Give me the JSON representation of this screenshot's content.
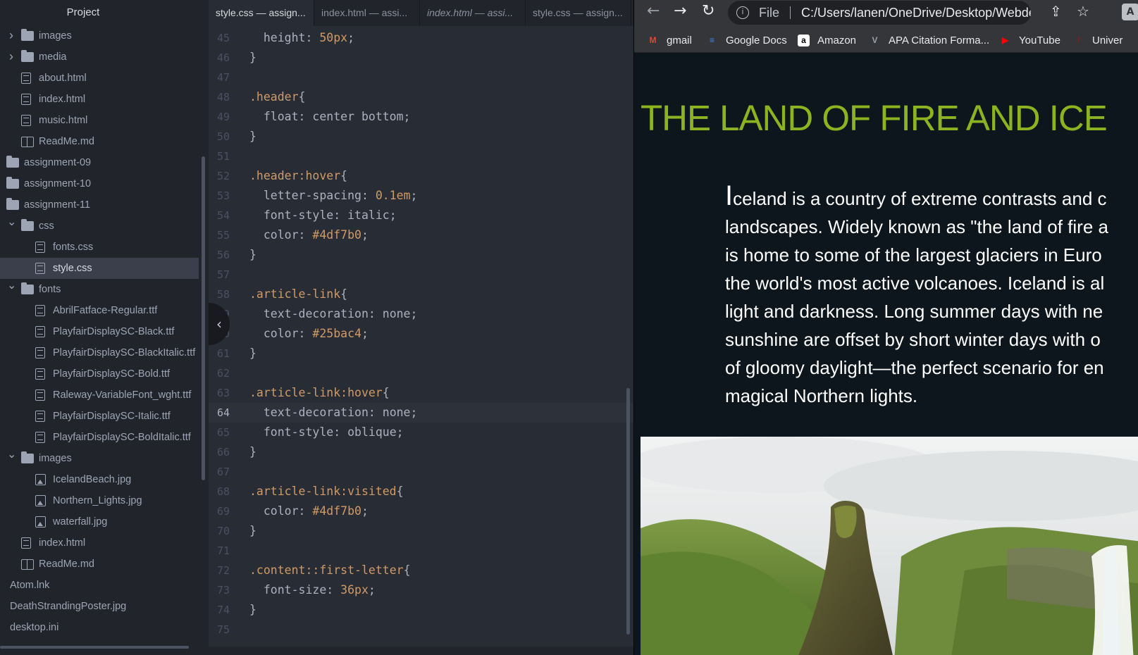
{
  "tree": {
    "title": "Project",
    "items": [
      {
        "label": "images",
        "type": "folder",
        "depth": 1,
        "chevron": "right"
      },
      {
        "label": "media",
        "type": "folder",
        "depth": 1,
        "chevron": "right"
      },
      {
        "label": "about.html",
        "type": "file",
        "depth": 1
      },
      {
        "label": "index.html",
        "type": "file",
        "depth": 1
      },
      {
        "label": "music.html",
        "type": "file",
        "depth": 1
      },
      {
        "label": "ReadMe.md",
        "type": "book",
        "depth": 1
      },
      {
        "label": "assignment-09",
        "type": "folder",
        "depth": 0
      },
      {
        "label": "assignment-10",
        "type": "folder",
        "depth": 0
      },
      {
        "label": "assignment-11",
        "type": "folder",
        "depth": 0
      },
      {
        "label": "css",
        "type": "folder",
        "depth": 1,
        "chevron": "down"
      },
      {
        "label": "fonts.css",
        "type": "file",
        "depth": 2
      },
      {
        "label": "style.css",
        "type": "file",
        "depth": 2,
        "selected": true
      },
      {
        "label": "fonts",
        "type": "folder",
        "depth": 1,
        "chevron": "down"
      },
      {
        "label": "AbrilFatface-Regular.ttf",
        "type": "file",
        "depth": 2
      },
      {
        "label": "PlayfairDisplaySC-Black.ttf",
        "type": "file",
        "depth": 2
      },
      {
        "label": "PlayfairDisplaySC-BlackItalic.ttf",
        "type": "file",
        "depth": 2
      },
      {
        "label": "PlayfairDisplaySC-Bold.ttf",
        "type": "file",
        "depth": 2
      },
      {
        "label": "Raleway-VariableFont_wght.ttf",
        "type": "file",
        "depth": 2
      },
      {
        "label": "PlayfairDisplaySC-Italic.ttf",
        "type": "file",
        "depth": 2
      },
      {
        "label": "PlayfairDisplaySC-BoldItalic.ttf",
        "type": "file",
        "depth": 2
      },
      {
        "label": "images",
        "type": "folder",
        "depth": 1,
        "chevron": "down"
      },
      {
        "label": "IcelandBeach.jpg",
        "type": "image",
        "depth": 2
      },
      {
        "label": "Northern_Lights.jpg",
        "type": "image",
        "depth": 2
      },
      {
        "label": "waterfall.jpg",
        "type": "image",
        "depth": 2
      },
      {
        "label": "index.html",
        "type": "file",
        "depth": 1
      },
      {
        "label": "ReadMe.md",
        "type": "book",
        "depth": 1
      },
      {
        "label": "Atom.lnk",
        "type": "none",
        "depth": -1
      },
      {
        "label": "DeathStrandingPoster.jpg",
        "type": "none",
        "depth": -1
      },
      {
        "label": "desktop.ini",
        "type": "none",
        "depth": -1
      }
    ]
  },
  "editor": {
    "tabs": [
      {
        "label": "style.css — assign...",
        "active": true,
        "italic": false
      },
      {
        "label": "index.html — assi...",
        "active": false,
        "italic": false
      },
      {
        "label": "index.html — assi...",
        "active": false,
        "italic": true
      },
      {
        "label": "style.css — assign...",
        "active": false,
        "italic": false
      }
    ],
    "current_line": "64",
    "lines": [
      {
        "n": "45",
        "tokens": [
          [
            "  ",
            "pun"
          ],
          [
            "height",
            "prop"
          ],
          [
            ": ",
            "pun"
          ],
          [
            "50px",
            "num"
          ],
          [
            ";",
            "pun"
          ]
        ]
      },
      {
        "n": "46",
        "tokens": [
          [
            "}",
            "pun"
          ]
        ]
      },
      {
        "n": "47",
        "tokens": []
      },
      {
        "n": "48",
        "tokens": [
          [
            ".header",
            "sel"
          ],
          [
            "{",
            "pun"
          ]
        ]
      },
      {
        "n": "49",
        "tokens": [
          [
            "  ",
            "pun"
          ],
          [
            "float",
            "prop"
          ],
          [
            ": center bottom;",
            "pun"
          ]
        ]
      },
      {
        "n": "50",
        "tokens": [
          [
            "}",
            "pun"
          ]
        ]
      },
      {
        "n": "51",
        "tokens": []
      },
      {
        "n": "52",
        "tokens": [
          [
            ".header",
            "sel"
          ],
          [
            ":hover",
            "sel"
          ],
          [
            "{",
            "pun"
          ]
        ]
      },
      {
        "n": "53",
        "tokens": [
          [
            "  ",
            "pun"
          ],
          [
            "letter-spacing",
            "prop"
          ],
          [
            ": ",
            "pun"
          ],
          [
            "0.1em",
            "num"
          ],
          [
            ";",
            "pun"
          ]
        ]
      },
      {
        "n": "54",
        "tokens": [
          [
            "  ",
            "pun"
          ],
          [
            "font-style",
            "prop"
          ],
          [
            ": italic;",
            "pun"
          ]
        ]
      },
      {
        "n": "55",
        "tokens": [
          [
            "  ",
            "pun"
          ],
          [
            "color",
            "prop"
          ],
          [
            ": ",
            "pun"
          ],
          [
            "#4df7b0",
            "num"
          ],
          [
            ";",
            "pun"
          ]
        ]
      },
      {
        "n": "56",
        "tokens": [
          [
            "}",
            "pun"
          ]
        ]
      },
      {
        "n": "57",
        "tokens": []
      },
      {
        "n": "58",
        "tokens": [
          [
            ".article-link",
            "sel"
          ],
          [
            "{",
            "pun"
          ]
        ]
      },
      {
        "n": "59",
        "tokens": [
          [
            "  ",
            "pun"
          ],
          [
            "text-decoration",
            "prop"
          ],
          [
            ": none;",
            "pun"
          ]
        ]
      },
      {
        "n": "60",
        "tokens": [
          [
            "  ",
            "pun"
          ],
          [
            "color",
            "prop"
          ],
          [
            ": ",
            "pun"
          ],
          [
            "#25bac4",
            "num"
          ],
          [
            ";",
            "pun"
          ]
        ]
      },
      {
        "n": "61",
        "tokens": [
          [
            "}",
            "pun"
          ]
        ]
      },
      {
        "n": "62",
        "tokens": []
      },
      {
        "n": "63",
        "tokens": [
          [
            ".article-link",
            "sel"
          ],
          [
            ":hover",
            "sel"
          ],
          [
            "{",
            "pun"
          ]
        ]
      },
      {
        "n": "64",
        "tokens": [
          [
            "  ",
            "pun"
          ],
          [
            "text-decoration",
            "prop"
          ],
          [
            ": none;",
            "pun"
          ]
        ]
      },
      {
        "n": "65",
        "tokens": [
          [
            "  ",
            "pun"
          ],
          [
            "font-style",
            "prop"
          ],
          [
            ": oblique;",
            "pun"
          ]
        ]
      },
      {
        "n": "66",
        "tokens": [
          [
            "}",
            "pun"
          ]
        ]
      },
      {
        "n": "67",
        "tokens": []
      },
      {
        "n": "68",
        "tokens": [
          [
            ".article-link",
            "sel"
          ],
          [
            ":visited",
            "sel"
          ],
          [
            "{",
            "pun"
          ]
        ]
      },
      {
        "n": "69",
        "tokens": [
          [
            "  ",
            "pun"
          ],
          [
            "color",
            "prop"
          ],
          [
            ": ",
            "pun"
          ],
          [
            "#4df7b0",
            "num"
          ],
          [
            ";",
            "pun"
          ]
        ]
      },
      {
        "n": "70",
        "tokens": [
          [
            "}",
            "pun"
          ]
        ]
      },
      {
        "n": "71",
        "tokens": []
      },
      {
        "n": "72",
        "tokens": [
          [
            ".content",
            "sel"
          ],
          [
            "::first-letter",
            "sel"
          ],
          [
            "{",
            "pun"
          ]
        ]
      },
      {
        "n": "73",
        "tokens": [
          [
            "  ",
            "pun"
          ],
          [
            "font-size",
            "prop"
          ],
          [
            ": ",
            "pun"
          ],
          [
            "36px",
            "num"
          ],
          [
            ";",
            "pun"
          ]
        ]
      },
      {
        "n": "74",
        "tokens": [
          [
            "}",
            "pun"
          ]
        ]
      },
      {
        "n": "75",
        "tokens": []
      }
    ]
  },
  "browser": {
    "omnibox": {
      "scheme": "File",
      "url": "C:/Users/lanen/OneDrive/Desktop/Webdesi..."
    },
    "bookmarks": [
      {
        "label": "gmail",
        "icon": "gmail-icon",
        "color": "#ea4335",
        "glyph": "M"
      },
      {
        "label": "Google Docs",
        "icon": "google-docs-icon",
        "color": "#4285f4",
        "glyph": "≡"
      },
      {
        "label": "Amazon",
        "icon": "amazon-icon",
        "color": "#ffffff",
        "glyph": "a"
      },
      {
        "label": "APA Citation Forma...",
        "icon": "apa-citation-icon",
        "color": "#9aa0a6",
        "glyph": "V"
      },
      {
        "label": "YouTube",
        "icon": "youtube-icon",
        "color": "#ff0000",
        "glyph": "▶"
      },
      {
        "label": "Univer",
        "icon": "university-icon",
        "color": "#8b1a1a",
        "glyph": "/"
      }
    ],
    "page": {
      "title": "THE LAND OF FIRE AND ICE",
      "first_letter": "I",
      "intro_lines": [
        "celand is a country of extreme contrasts and c",
        "landscapes. Widely known as \"the land of fire a",
        "is home to some of the largest glaciers in Euro",
        "the world's most active volcanoes. Iceland is al",
        "light and darkness. Long summer days with ne",
        "sunshine are offset by short winter days with o",
        "of gloomy daylight—the perfect scenario for en",
        "magical Northern lights."
      ],
      "title_color": "#8cb421"
    }
  }
}
